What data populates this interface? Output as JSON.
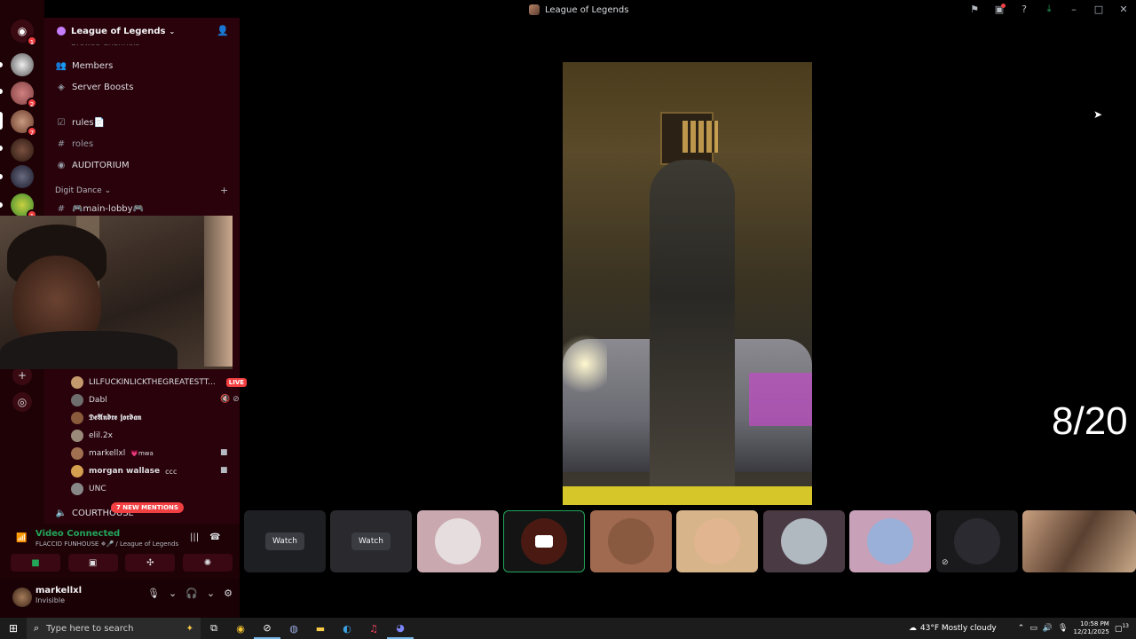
{
  "window": {
    "title": "League of Legends",
    "icons": [
      "inbox-icon",
      "screen-share-icon",
      "help-icon",
      "download-icon",
      "minimize-icon",
      "maximize-icon",
      "close-icon"
    ]
  },
  "rail": {
    "badges": [
      "1",
      "2",
      "7",
      "1"
    ]
  },
  "server": {
    "name": "League of Legends",
    "hidden_channel": "Browse Channels",
    "items": [
      {
        "label": "Members",
        "icon": "members-icon"
      },
      {
        "label": "Server Boosts",
        "icon": "boost-icon"
      }
    ],
    "channels": [
      {
        "label": "rules📄",
        "icon": "rules-icon"
      },
      {
        "label": "roles",
        "icon": "hash-icon"
      },
      {
        "label": "AUDITORIUM",
        "icon": "stage-icon"
      }
    ],
    "category": "Digit Dance",
    "lobby": "🎮main-lobby🎮"
  },
  "voice_members": [
    {
      "name": "LILFUCKINLICKTHEGREATESTT...",
      "live": "LIVE",
      "color": "#c49a6c"
    },
    {
      "name": "Dabl",
      "color": "#6e6e6e"
    },
    {
      "name": "𝕯𝖊𝕬𝖓𝖉𝖗𝖊 𝖏𝖔𝖗𝖉𝖆𝖓",
      "color": "#8a5a3c"
    },
    {
      "name": "elil.2x",
      "color": "#9a8a7a"
    },
    {
      "name": "markellxl",
      "tag": "💗mwa",
      "color": "#a07050"
    },
    {
      "name": "morgan wallase",
      "tag": "ccc",
      "color": "#d4a050"
    },
    {
      "name": "UNC",
      "color": "#888888"
    }
  ],
  "courthouse": "COURTHOUSE",
  "mentions_badge": "7 NEW MENTIONS",
  "voice": {
    "status": "Video Connected",
    "location": "FLACCID FUNHOUSE ✵🎤 / League of Legends"
  },
  "user": {
    "name": "markellxl",
    "status": "Invisible"
  },
  "stage": {
    "counter": "8/20"
  },
  "tiles": [
    {
      "type": "watch",
      "label": "Watch"
    },
    {
      "type": "watch",
      "label": "Watch"
    },
    {
      "type": "avatar",
      "color": "#e6dede"
    },
    {
      "type": "camera",
      "color": "#4a1a12"
    },
    {
      "type": "avatar",
      "color": "#8a5a40"
    },
    {
      "type": "avatar",
      "color": "#e0b590"
    },
    {
      "type": "avatar",
      "color": "#b0b8c0"
    },
    {
      "type": "avatar",
      "color": "#9ab0d8"
    },
    {
      "type": "avatar",
      "color": "#2a2a30"
    },
    {
      "type": "video",
      "color": "#5a4030"
    }
  ],
  "taskbar": {
    "search_placeholder": "Type here to search",
    "weather": "43°F  Mostly cloudy",
    "time": "10:58 PM",
    "date": "12/21/2025",
    "notifications": "13"
  }
}
